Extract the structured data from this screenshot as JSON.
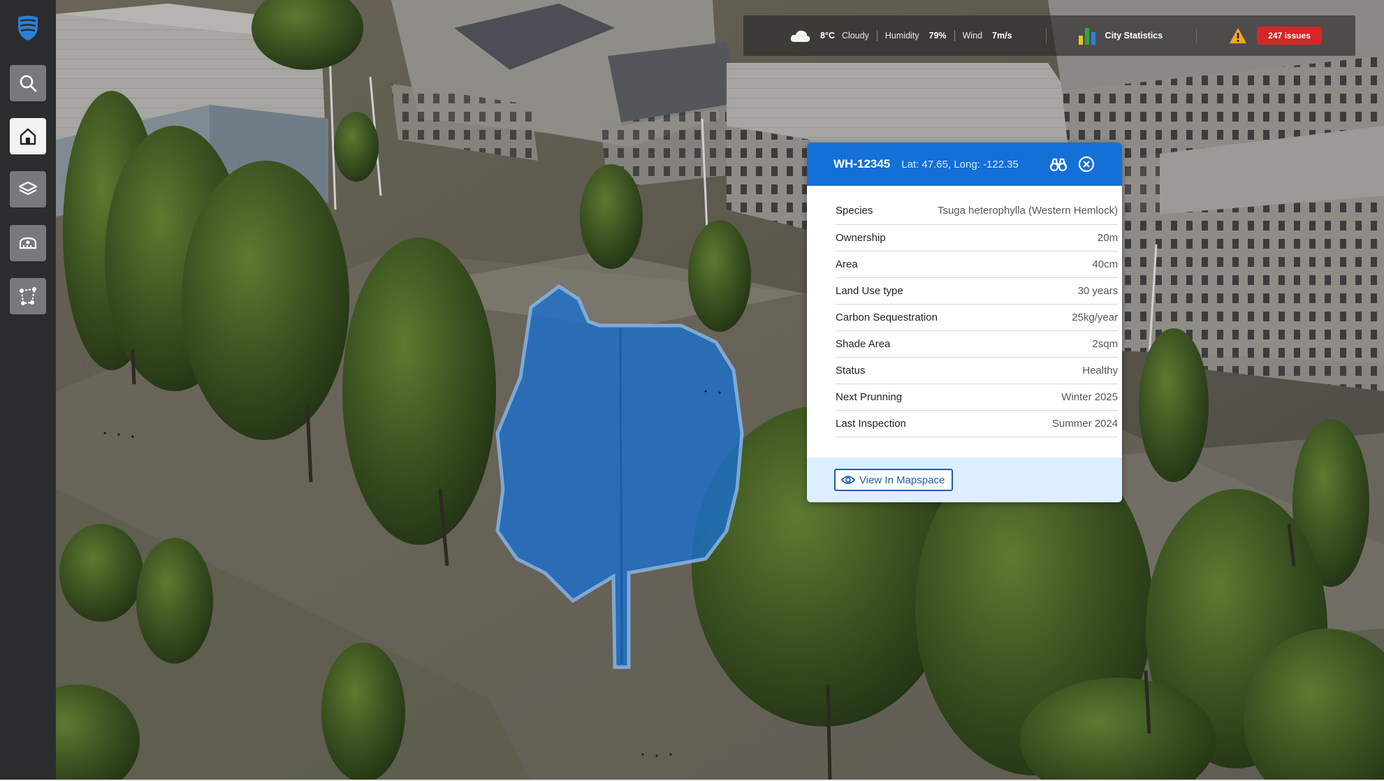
{
  "sidebar": {
    "logo_icon": "app-logo-icon",
    "items": [
      {
        "name": "search",
        "icon": "search-icon",
        "active": false
      },
      {
        "name": "home",
        "icon": "home-icon",
        "active": true
      },
      {
        "name": "layers",
        "icon": "layers-icon",
        "active": false
      },
      {
        "name": "measure",
        "icon": "measure-icon",
        "active": false
      },
      {
        "name": "polygon",
        "icon": "polygon-draw-icon",
        "active": false
      }
    ]
  },
  "topbar": {
    "weather": {
      "icon": "cloud-icon",
      "temperature": "8°C",
      "condition": "Cloudy"
    },
    "humidity": {
      "label": "Humidity",
      "value": "79%"
    },
    "wind": {
      "label": "Wind",
      "value": "7m/s"
    },
    "stats": {
      "icon": "bar-chart-icon",
      "label": "City Statistics"
    },
    "alerts": {
      "icon": "warning-icon",
      "issues_label": "247 issues"
    }
  },
  "panel": {
    "id": "WH-12345",
    "coords": "Lat: 47.65, Long: -122.35",
    "header_icons": [
      "binoculars-icon",
      "close-circle-icon"
    ],
    "rows": [
      {
        "label": "Species",
        "value": "Tsuga heterophylla (Western Hemlock)"
      },
      {
        "label": "Ownership",
        "value": "20m"
      },
      {
        "label": "Area",
        "value": "40cm"
      },
      {
        "label": "Land Use type",
        "value": "30 years"
      },
      {
        "label": "Carbon Sequestration",
        "value": "25kg/year"
      },
      {
        "label": "Shade Area",
        "value": "2sqm"
      },
      {
        "label": "Status",
        "value": "Healthy"
      },
      {
        "label": "Next Prunning",
        "value": "Winter 2025"
      },
      {
        "label": "Last Inspection",
        "value": "Summer 2024"
      }
    ],
    "view_button": {
      "icon": "eye-icon",
      "label": "View In Mapspace"
    }
  },
  "colors": {
    "sidebar_bg": "#2b2c2e",
    "panel_header": "#1470d6",
    "panel_footer": "#dceeff",
    "highlight": "#1a6fcf",
    "issues_badge": "#d42626"
  }
}
